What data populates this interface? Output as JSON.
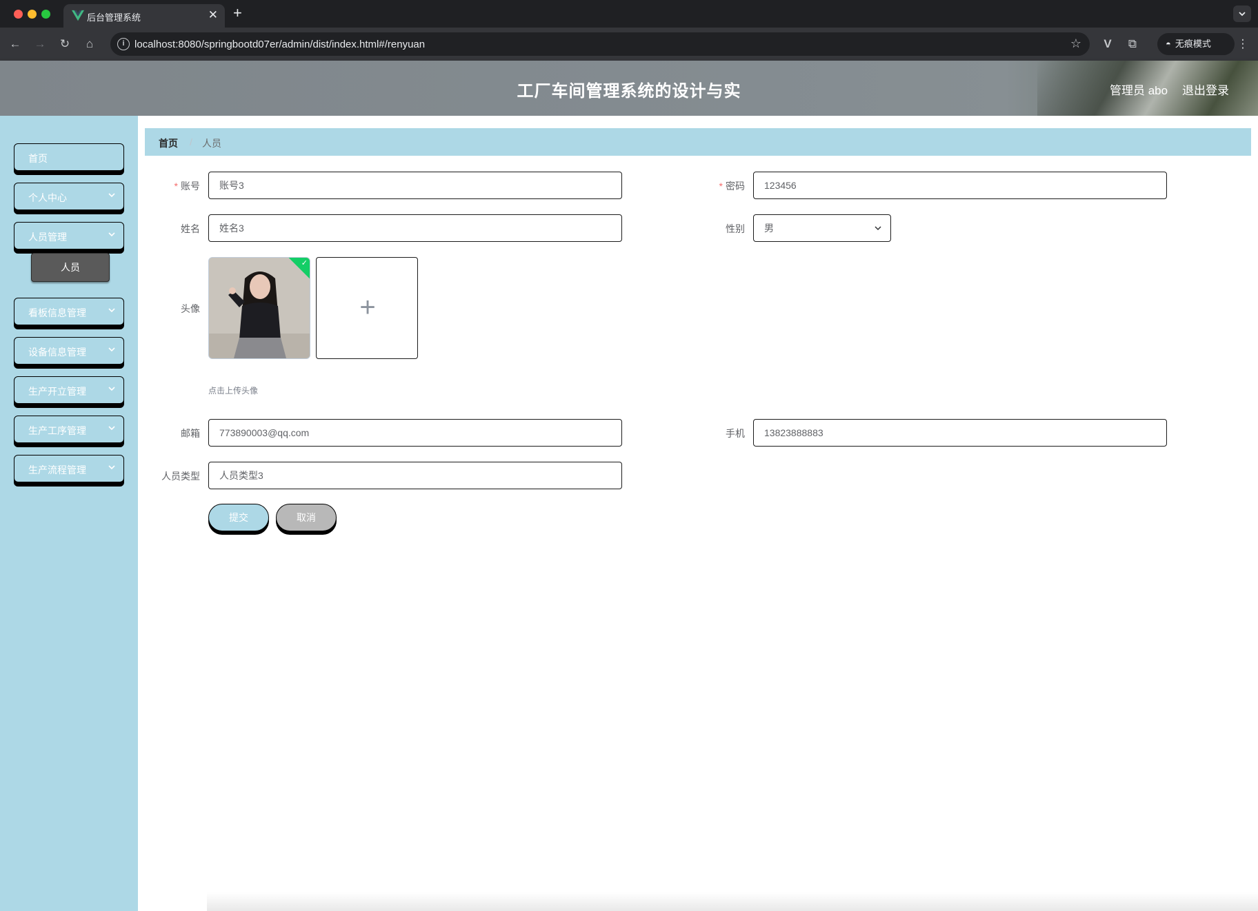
{
  "browser": {
    "tab_title": "后台管理系统",
    "tab_close": "✕",
    "new_tab": "+",
    "url": "localhost:8080/springbootd07er/admin/dist/index.html#/renyuan",
    "incognito_label": "无痕模式",
    "icons": [
      "back-arrow-icon",
      "forward-arrow-icon",
      "reload-icon",
      "home-icon",
      "info-icon",
      "star-icon",
      "vue-devtools-icon",
      "extensions-icon",
      "incognito-icon",
      "more-vert-icon"
    ]
  },
  "header": {
    "title": "工厂车间管理系统的设计与实",
    "user": "管理员 abo",
    "logout": "退出登录"
  },
  "sidebar": {
    "items": [
      {
        "label": "首页"
      },
      {
        "label": "个人中心"
      },
      {
        "label": "人员管理"
      },
      {
        "label": "看板信息管理"
      },
      {
        "label": "设备信息管理"
      },
      {
        "label": "生产开立管理"
      },
      {
        "label": "生产工序管理"
      },
      {
        "label": "生产流程管理"
      }
    ],
    "sub_items": [
      {
        "label": "人员"
      }
    ]
  },
  "breadcrumb": {
    "home": "首页",
    "separator": "/",
    "current": "人员"
  },
  "form": {
    "account": {
      "label": "账号",
      "value": "账号3",
      "required": "*"
    },
    "password": {
      "label": "密码",
      "value": "123456",
      "required": "*"
    },
    "name": {
      "label": "姓名",
      "value": "姓名3"
    },
    "gender": {
      "label": "性别",
      "value": "男"
    },
    "avatar": {
      "label": "头像",
      "tip": "点击上传头像",
      "plus": "+",
      "check": "✓"
    },
    "email": {
      "label": "邮箱",
      "value": "773890003@qq.com"
    },
    "phone": {
      "label": "手机",
      "value": "13823888883"
    },
    "person_type": {
      "label": "人员类型",
      "value": "人员类型3"
    },
    "submit": "提交",
    "cancel": "取消"
  },
  "colors": {
    "sidebar_bg": "#add8e6",
    "required": "#f56c6c",
    "success_badge": "#13ce66",
    "cancel_button": "#b8b8b8",
    "submenu_active": "#5a5a5a"
  }
}
